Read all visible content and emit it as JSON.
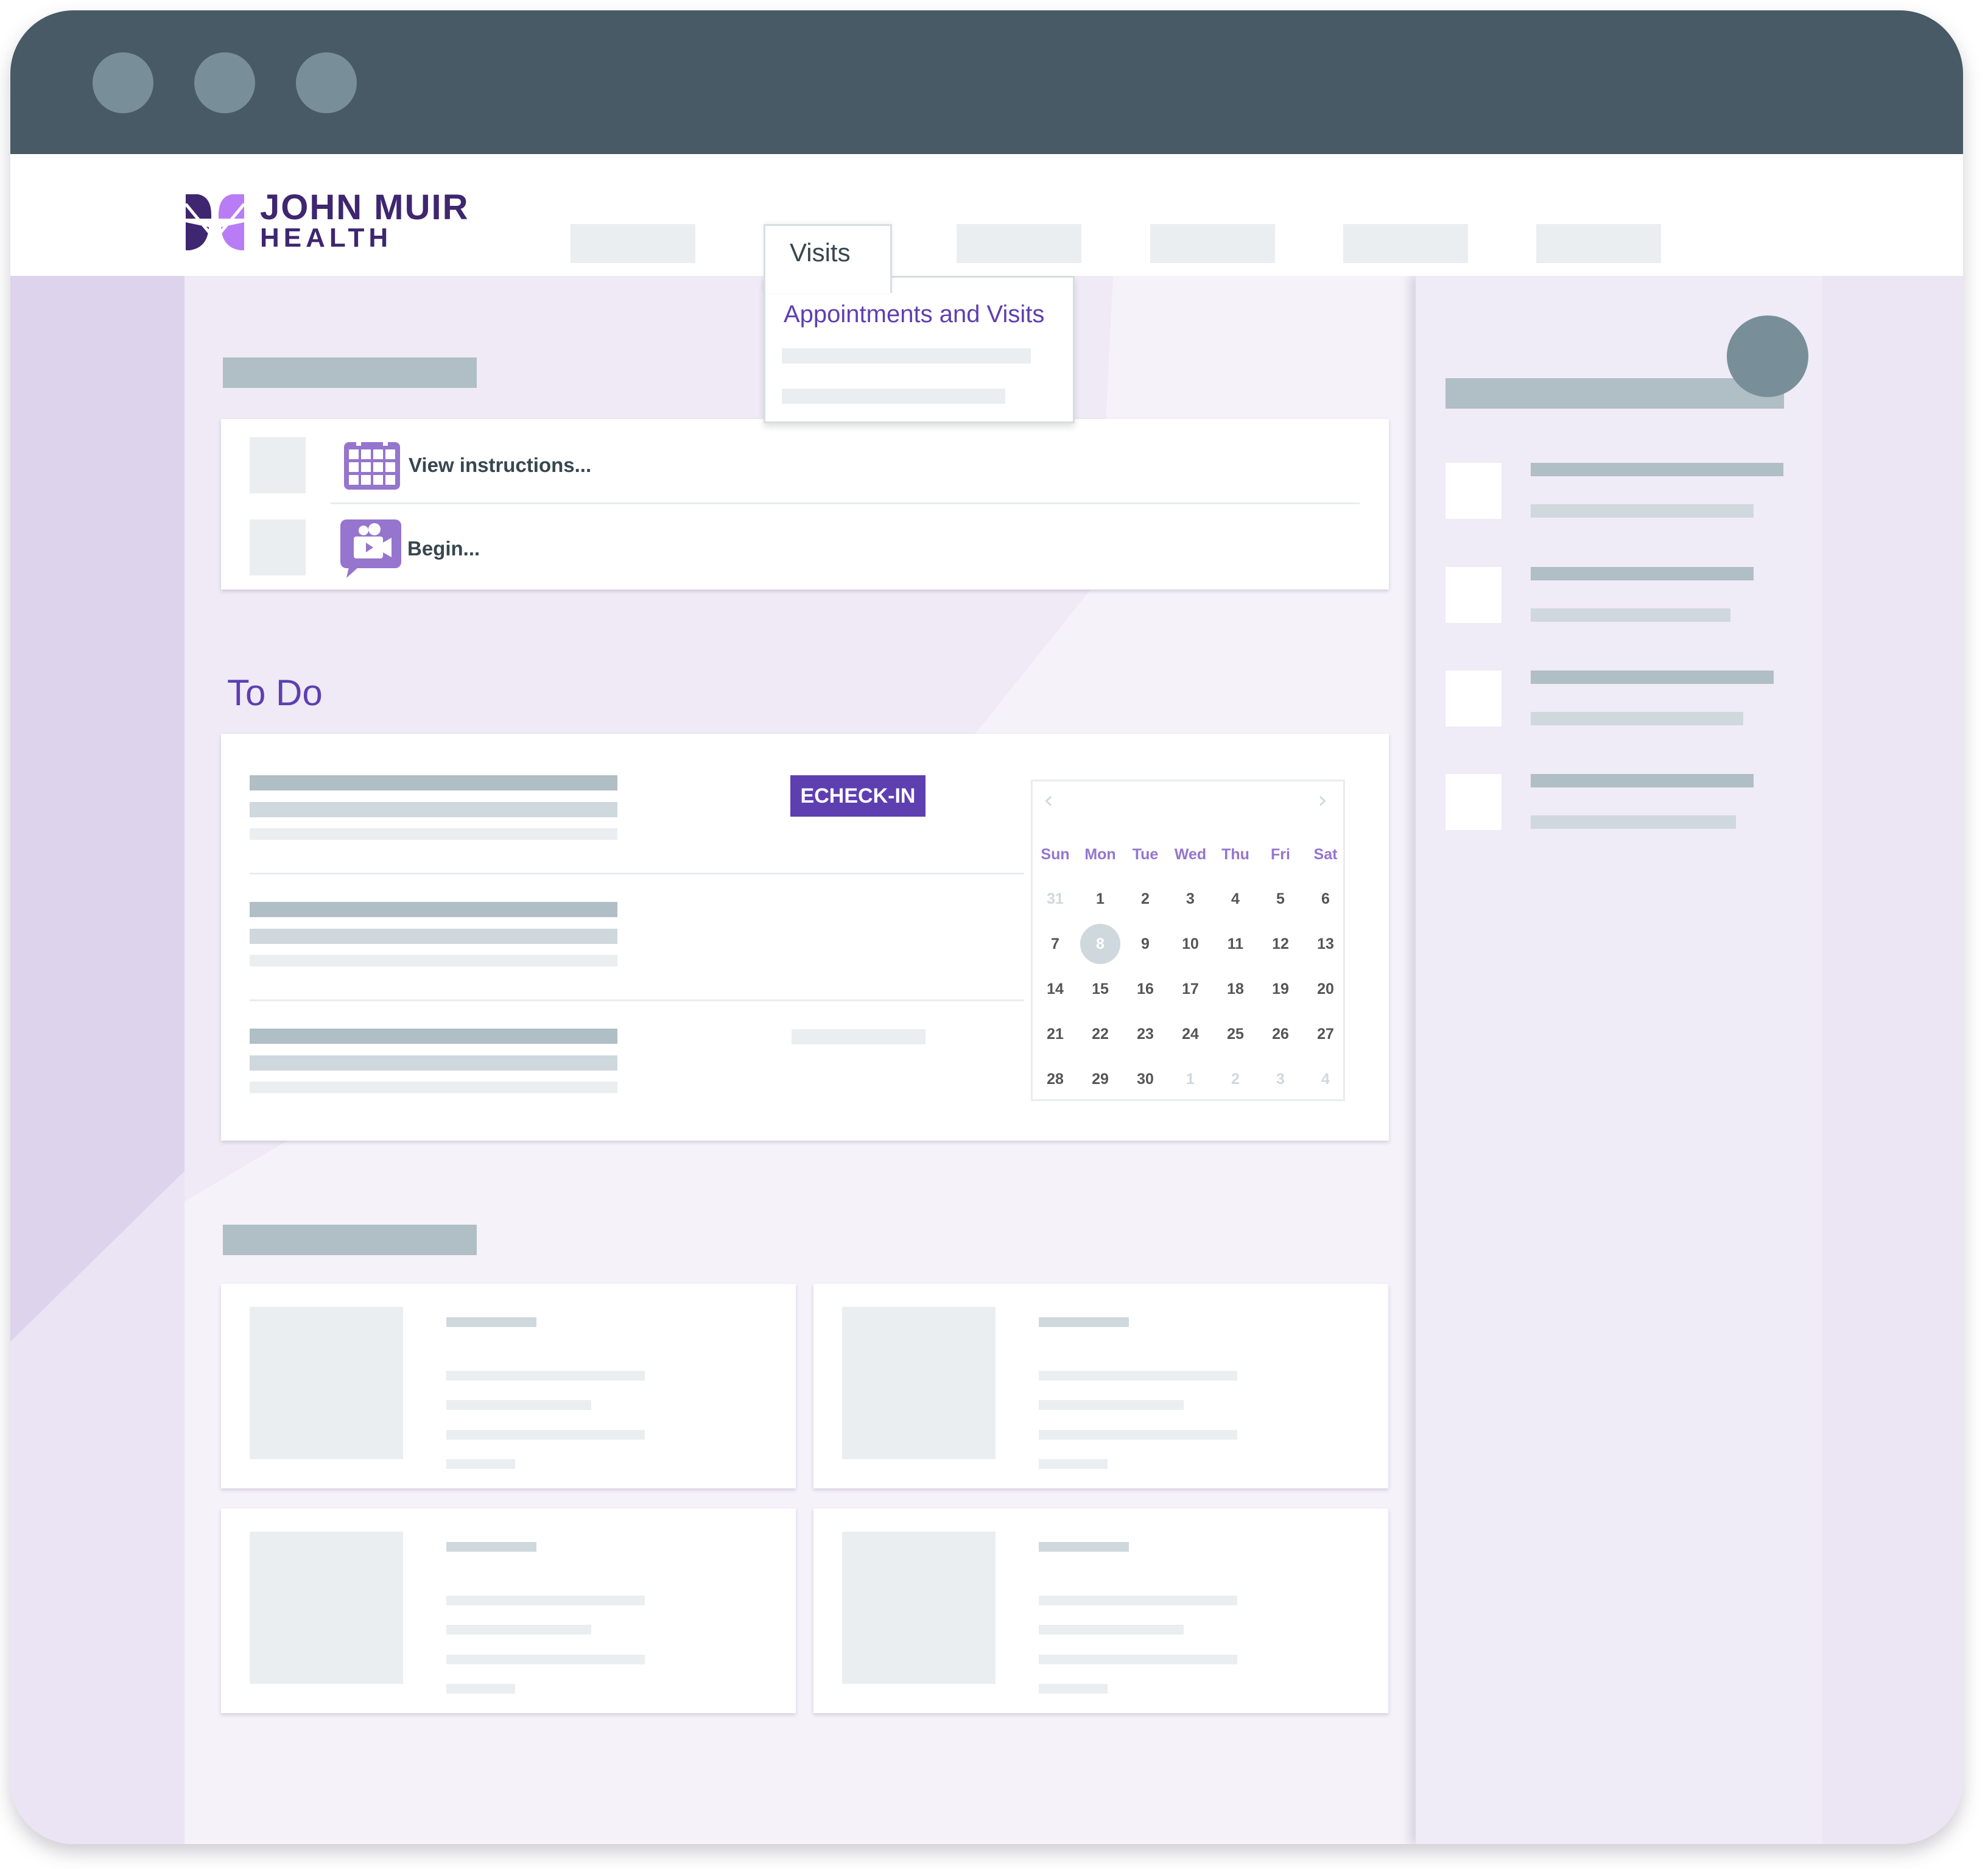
{
  "brand": {
    "name_line1": "JOHN MUIR",
    "name_line2": "HEALTH",
    "colors": {
      "primary": "#5e3fb0",
      "logo_dark": "#3e2670",
      "logo_light": "#b97cf7",
      "titlebar": "#475a66"
    }
  },
  "window": {
    "controls": [
      "window-dot",
      "window-dot",
      "window-dot"
    ]
  },
  "nav": {
    "active_tab": "Visits",
    "dropdown": {
      "title": "Appointments and Visits"
    }
  },
  "quick_links": [
    {
      "icon": "calendar-icon",
      "label": "View instructions..."
    },
    {
      "icon": "video-chat-icon",
      "label": "Begin..."
    }
  ],
  "todo": {
    "title": "To Do",
    "echeckin_label": "ECHECK-IN",
    "calendar": {
      "prev_icon": "‹",
      "next_icon": "›",
      "weekdays": [
        "Sun",
        "Mon",
        "Tue",
        "Wed",
        "Thu",
        "Fri",
        "Sat"
      ],
      "selected_day": "8",
      "weeks": [
        [
          {
            "d": "31",
            "m": true
          },
          {
            "d": "1"
          },
          {
            "d": "2"
          },
          {
            "d": "3"
          },
          {
            "d": "4"
          },
          {
            "d": "5"
          },
          {
            "d": "6"
          }
        ],
        [
          {
            "d": "7"
          },
          {
            "d": "8",
            "s": true
          },
          {
            "d": "9"
          },
          {
            "d": "10"
          },
          {
            "d": "11"
          },
          {
            "d": "12"
          },
          {
            "d": "13"
          }
        ],
        [
          {
            "d": "14"
          },
          {
            "d": "15"
          },
          {
            "d": "16"
          },
          {
            "d": "17"
          },
          {
            "d": "18"
          },
          {
            "d": "19"
          },
          {
            "d": "20"
          }
        ],
        [
          {
            "d": "21"
          },
          {
            "d": "22"
          },
          {
            "d": "23"
          },
          {
            "d": "24"
          },
          {
            "d": "25"
          },
          {
            "d": "26"
          },
          {
            "d": "27"
          }
        ],
        [
          {
            "d": "28"
          },
          {
            "d": "29"
          },
          {
            "d": "30"
          },
          {
            "d": "1",
            "m": true
          },
          {
            "d": "2",
            "m": true
          },
          {
            "d": "3",
            "m": true
          },
          {
            "d": "4",
            "m": true
          }
        ]
      ]
    }
  }
}
